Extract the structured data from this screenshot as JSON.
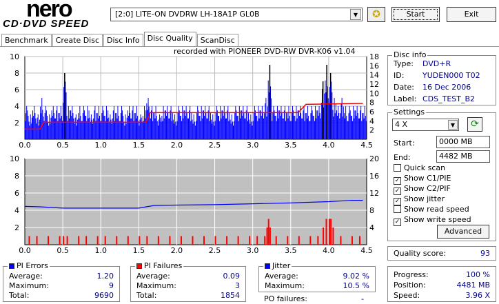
{
  "app": {
    "logo_top": "nero",
    "logo_bottom": "CD·DVD SPEED"
  },
  "toolbar": {
    "drive": "[2:0]  LITE-ON DVDRW LH-18A1P GL0B",
    "start": "Start",
    "exit": "Exit"
  },
  "tabs": [
    {
      "label": "Benchmark"
    },
    {
      "label": "Create Disc"
    },
    {
      "label": "Disc Info"
    },
    {
      "label": "Disc Quality",
      "active": true
    },
    {
      "label": "ScanDisc"
    }
  ],
  "recorded_with": "recorded with PIONEER DVD-RW  DVR-K06  v1.04",
  "disc_info": {
    "title": "Disc info",
    "type_label": "Type:",
    "type": "DVD+R",
    "id_label": "ID:",
    "id": "YUDEN000 T02",
    "date_label": "Date:",
    "date": "16 Dec 2006",
    "label_label": "Label:",
    "label": "CDS_TEST_B2"
  },
  "settings": {
    "title": "Settings",
    "speed": "4 X",
    "start_label": "Start:",
    "start": "0000 MB",
    "end_label": "End:",
    "end": "4482 MB",
    "options": [
      {
        "label": "Quick scan",
        "checked": false
      },
      {
        "label": "Show C1/PIE",
        "checked": true
      },
      {
        "label": "Show C2/PIF",
        "checked": true
      },
      {
        "label": "Show jitter",
        "checked": true
      },
      {
        "label": "Show read speed",
        "checked": false
      },
      {
        "label": "Show write speed",
        "checked": true
      }
    ],
    "advanced": "Advanced"
  },
  "quality": {
    "label": "Quality score:",
    "value": "93"
  },
  "progress": {
    "progress_label": "Progress:",
    "progress": "100 %",
    "position_label": "Position:",
    "position": "4481 MB",
    "speed_label": "Speed:",
    "speed": "3.96 X"
  },
  "pi_errors": {
    "title": "PI Errors",
    "color": "#0000ff",
    "average_label": "Average:",
    "average": "1.20",
    "maximum_label": "Maximum:",
    "maximum": "9",
    "total_label": "Total:",
    "total": "9690"
  },
  "pi_failures": {
    "title": "PI Failures",
    "color": "#ff0000",
    "average_label": "Average:",
    "average": "0.09",
    "maximum_label": "Maximum:",
    "maximum": "3",
    "total_label": "Total:",
    "total": "1854"
  },
  "jitter": {
    "title": "Jitter",
    "color": "#0000ff",
    "average_label": "Average:",
    "average": "9.02 %",
    "maximum_label": "Maximum:",
    "maximum": "10.5 %",
    "po_label": "PO failures:",
    "po": "-"
  },
  "chart_data": [
    {
      "type": "bar",
      "name": "PI Errors / write speed",
      "xlim": [
        0,
        4.5
      ],
      "ylim": [
        0,
        10
      ],
      "y2lim": [
        0,
        18
      ],
      "xticks": [
        "0.0",
        "0.5",
        "1.0",
        "1.5",
        "2.0",
        "2.5",
        "3.0",
        "3.5",
        "4.0",
        "4.5"
      ],
      "yticks": [
        "2",
        "4",
        "6",
        "8",
        "10"
      ],
      "y2ticks": [
        "2",
        "4",
        "6",
        "8",
        "10",
        "12",
        "14",
        "16",
        "18"
      ],
      "x": [
        0,
        0.05,
        0.1,
        0.15,
        0.2,
        0.25,
        0.3,
        0.35,
        0.4,
        0.45,
        0.5,
        0.55,
        0.6,
        0.65,
        0.7,
        0.75,
        0.8,
        0.85,
        0.9,
        0.95,
        1.0,
        1.05,
        1.1,
        1.15,
        1.2,
        1.25,
        1.3,
        1.35,
        1.4,
        1.45,
        1.5,
        1.55,
        1.6,
        1.65,
        1.7,
        1.75,
        1.8,
        1.85,
        1.9,
        1.95,
        2.0,
        2.05,
        2.1,
        2.15,
        2.2,
        2.25,
        2.3,
        2.35,
        2.4,
        2.45,
        2.5,
        2.55,
        2.6,
        2.65,
        2.7,
        2.75,
        2.8,
        2.85,
        2.9,
        2.95,
        3.0,
        3.05,
        3.1,
        3.15,
        3.2,
        3.25,
        3.3,
        3.35,
        3.4,
        3.45,
        3.5,
        3.55,
        3.6,
        3.65,
        3.7,
        3.75,
        3.8,
        3.85,
        3.9,
        3.95,
        4.0,
        4.05,
        4.1,
        4.15,
        4.2,
        4.25,
        4.3,
        4.35,
        4.4,
        4.45
      ],
      "pi_errors": [
        4,
        3,
        4,
        3,
        5,
        4,
        3,
        4,
        4,
        4,
        8,
        4,
        4,
        3,
        4,
        4,
        4,
        3,
        4,
        4,
        4,
        4,
        3,
        4,
        4,
        4,
        3,
        4,
        4,
        4,
        3,
        4,
        5,
        4,
        4,
        3,
        4,
        4,
        4,
        3,
        4,
        4,
        4,
        4,
        3,
        4,
        4,
        4,
        4,
        3,
        4,
        4,
        4,
        4,
        3,
        4,
        4,
        4,
        4,
        3,
        4,
        4,
        4,
        5,
        9,
        4,
        4,
        4,
        4,
        4,
        4,
        4,
        4,
        4,
        4,
        4,
        4,
        4,
        7,
        9,
        8,
        5,
        4,
        5,
        4,
        4,
        4,
        4,
        4,
        4
      ],
      "write_speed": {
        "x": [
          0,
          0.2,
          0.25,
          1.6,
          1.65,
          3.6,
          3.7,
          4.45
        ],
        "y": [
          2.2,
          2.2,
          3.7,
          3.7,
          5.8,
          5.8,
          7.6,
          7.8
        ]
      }
    },
    {
      "type": "line",
      "name": "PI Failures / jitter",
      "xlim": [
        0,
        4.5
      ],
      "ylim": [
        0,
        10
      ],
      "y2lim": [
        0,
        20
      ],
      "xticks": [
        "0.0",
        "0.5",
        "1.0",
        "1.5",
        "2.0",
        "2.5",
        "3.0",
        "3.5",
        "4.0",
        "4.5"
      ],
      "yticks": [
        "2",
        "4",
        "6",
        "8",
        "10"
      ],
      "y2ticks": [
        "4",
        "8",
        "12",
        "16",
        "20"
      ],
      "jitter": {
        "x": [
          0,
          0.2,
          0.5,
          1.0,
          1.5,
          1.6,
          1.7,
          2.0,
          2.5,
          3.0,
          3.5,
          4.0,
          4.3,
          4.45
        ],
        "y": [
          8.9,
          8.8,
          8.5,
          8.5,
          8.5,
          8.8,
          9.1,
          9.2,
          9.3,
          9.5,
          9.7,
          10.0,
          10.3,
          10.3
        ]
      },
      "pi_failures": {
        "x": [
          0.05,
          0.15,
          0.3,
          0.45,
          0.5,
          0.55,
          0.7,
          0.8,
          0.95,
          1.05,
          1.2,
          1.35,
          1.5,
          1.6,
          1.75,
          1.9,
          2.05,
          2.2,
          2.35,
          2.5,
          2.65,
          2.8,
          2.95,
          3.05,
          3.15,
          3.18,
          3.2,
          3.22,
          3.3,
          3.45,
          3.6,
          3.75,
          3.85,
          3.92,
          3.96,
          4.0,
          4.02,
          4.05,
          4.15,
          4.3,
          4.4
        ],
        "y": [
          1,
          1,
          1,
          1,
          1,
          1,
          1,
          1,
          1,
          1,
          1,
          1,
          1,
          1,
          1,
          1,
          1,
          1,
          1,
          1,
          1,
          1,
          1,
          1,
          1,
          2,
          3,
          2,
          1,
          1,
          1,
          1,
          1,
          2,
          3,
          3,
          3,
          2,
          1,
          1,
          1
        ]
      }
    }
  ]
}
